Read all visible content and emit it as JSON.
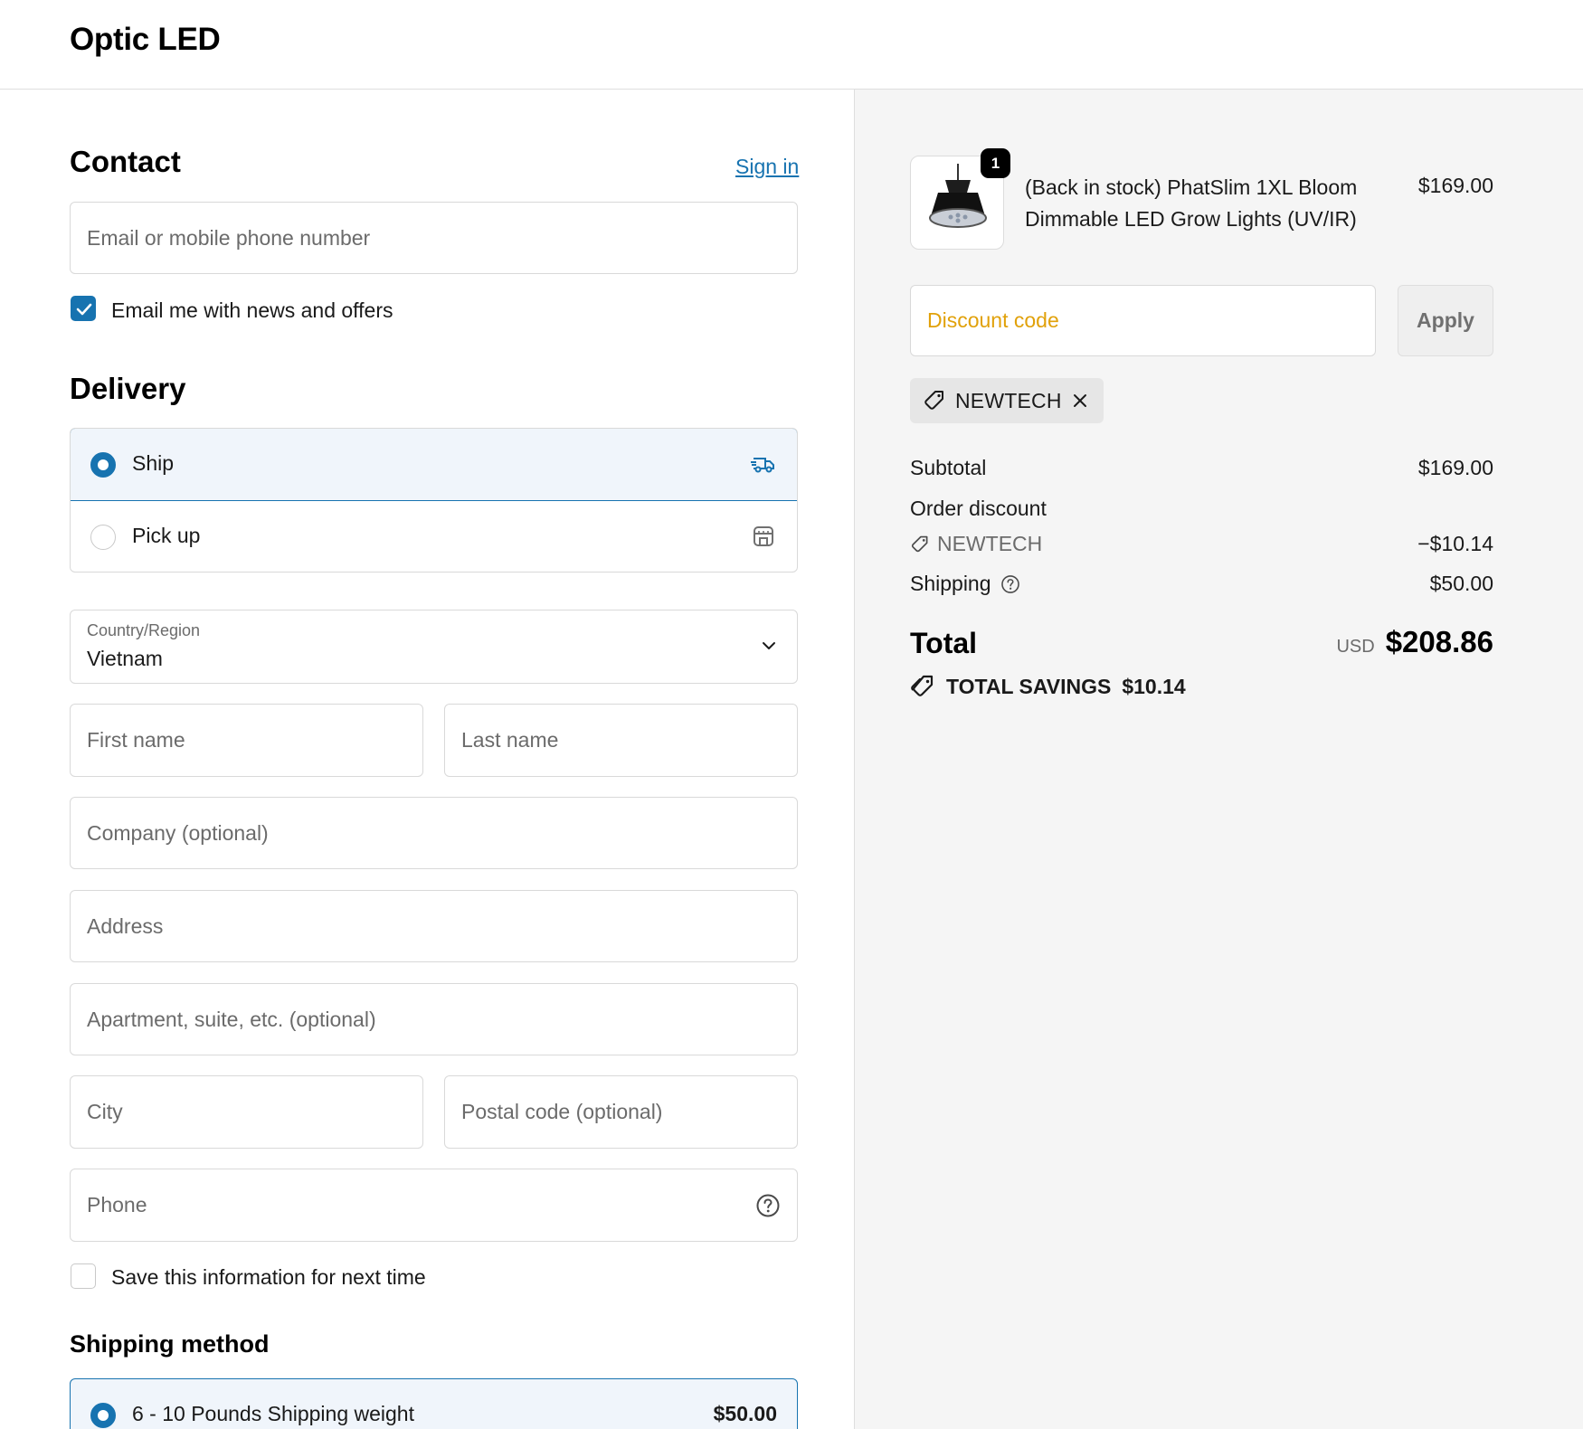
{
  "header": {
    "brand": "Optic LED"
  },
  "contact": {
    "title": "Contact",
    "sign_in": "Sign in",
    "email_placeholder": "Email or mobile phone number",
    "news_label": "Email me with news and offers",
    "news_checked": true
  },
  "delivery": {
    "title": "Delivery",
    "options": [
      {
        "label": "Ship",
        "selected": true,
        "icon": "truck-icon"
      },
      {
        "label": "Pick up",
        "selected": false,
        "icon": "store-icon"
      }
    ],
    "country_label": "Country/Region",
    "country_value": "Vietnam",
    "first_name_placeholder": "First name",
    "last_name_placeholder": "Last name",
    "company_placeholder": "Company (optional)",
    "address_placeholder": "Address",
    "apartment_placeholder": "Apartment, suite, etc. (optional)",
    "city_placeholder": "City",
    "postal_placeholder": "Postal code (optional)",
    "phone_placeholder": "Phone",
    "save_label": "Save this information for next time",
    "save_checked": false
  },
  "shipping_method": {
    "title": "Shipping method",
    "option_label": "6 - 10 Pounds Shipping weight",
    "option_price": "$50.00"
  },
  "summary": {
    "product": {
      "quantity": "1",
      "title": "(Back in stock) PhatSlim 1XL Bloom Dimmable LED Grow Lights (UV/IR)",
      "price": "$169.00"
    },
    "discount_placeholder": "Discount code",
    "apply_label": "Apply",
    "applied_code": "NEWTECH",
    "subtotal_label": "Subtotal",
    "subtotal_value": "$169.00",
    "order_discount_label": "Order discount",
    "discount_code": "NEWTECH",
    "discount_value": "−$10.14",
    "shipping_label": "Shipping",
    "shipping_value": "$50.00",
    "total_label": "Total",
    "currency": "USD",
    "total_value": "$208.86",
    "savings_label": "TOTAL SAVINGS",
    "savings_value": "$10.14"
  },
  "colors": {
    "accent": "#1773b0",
    "discount_placeholder": "#e1a10a",
    "summary_bg": "#f5f5f5"
  }
}
